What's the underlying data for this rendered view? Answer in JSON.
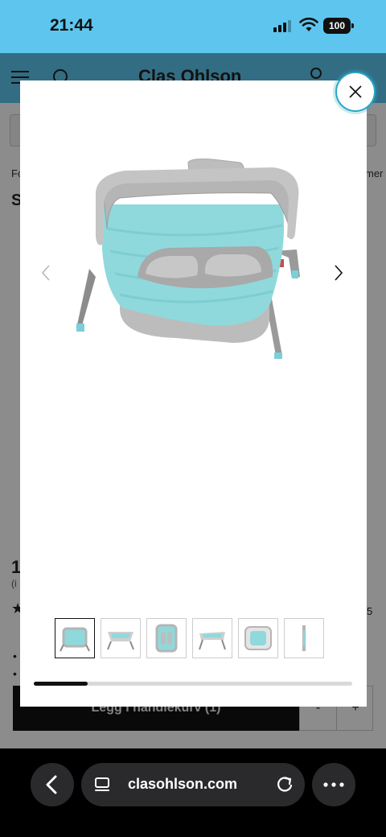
{
  "status_bar": {
    "time": "21:44",
    "battery": "100"
  },
  "site": {
    "logo": "Clas Ohlson",
    "breadcrumb_left": "Fo",
    "breadcrumb_right": "mer",
    "title_partial": "S",
    "price_partial": "1",
    "price_sub_partial": "(i",
    "rating_count_partial": "5",
    "add_to_cart_label": "Legg i handlekurv (1)",
    "qty_minus": "-",
    "qty_plus": "+"
  },
  "gallery": {
    "image_count": 6,
    "active_index": 0,
    "progress": 0.17,
    "icons": {
      "close": "close-icon",
      "prev": "chevron-left-icon",
      "next": "chevron-right-icon"
    }
  },
  "browser": {
    "url": "clasohlson.com",
    "icons": {
      "back": "back-arrow-icon",
      "tabs": "tabs-icon",
      "reload": "reload-icon",
      "more": "more-icon"
    }
  },
  "colors": {
    "brand_header": "#5ec6ee",
    "basin_teal": "#8fd9dc",
    "basin_gray": "#b5b5b5",
    "close_ring": "#2aa6c8"
  }
}
